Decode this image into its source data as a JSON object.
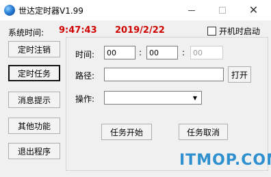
{
  "window": {
    "title": "世达定时器V1.99",
    "icon": "globe-icon"
  },
  "header": {
    "system_time_label": "系统时间:",
    "time": "9:47:43",
    "date": "2019/2/22",
    "startup_label": "开机时启动",
    "startup_checked": false
  },
  "sidebar": {
    "buttons": [
      {
        "label": "定时注销",
        "selected": false
      },
      {
        "label": "定时任务",
        "selected": true
      },
      {
        "label": "消息提示",
        "selected": false
      },
      {
        "label": "其他功能",
        "selected": false
      },
      {
        "label": "退出程序",
        "selected": false
      }
    ]
  },
  "task": {
    "time_label": "时间:",
    "hour": "00",
    "minute": "00",
    "second": "00",
    "separator": ":",
    "path_label": "路径:",
    "path_value": "",
    "open_label": "打开",
    "operation_label": "操作:",
    "operation_value": "",
    "start_label": "任务开始",
    "cancel_label": "任务取消"
  },
  "watermark": "ITMOP.COM",
  "colors": {
    "accent_text": "#d00000",
    "watermark": "#2f90d0"
  }
}
